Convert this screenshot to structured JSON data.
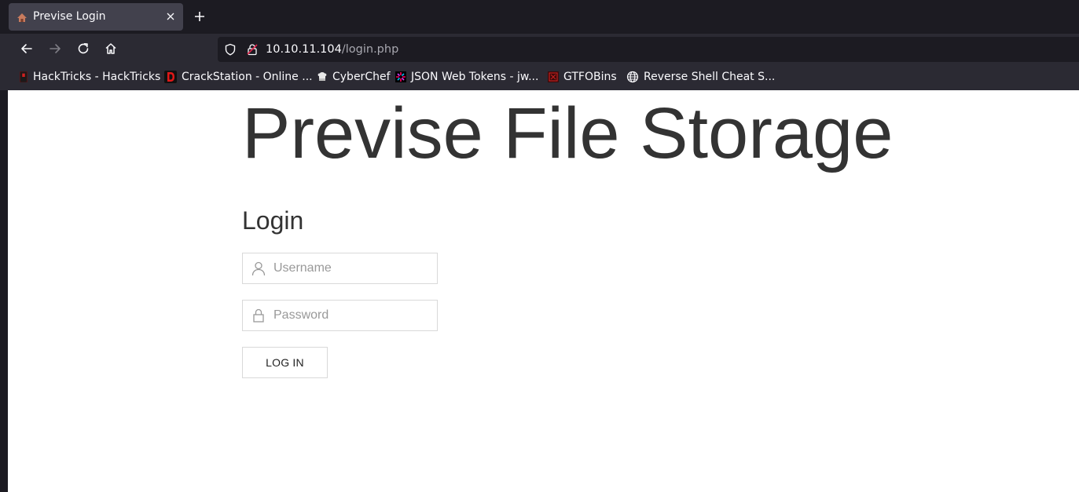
{
  "browser": {
    "tab": {
      "title": "Previse Login",
      "favicon": "previse-favicon-icon"
    },
    "address": {
      "host": "10.10.11.104",
      "path": "/login.php"
    },
    "bookmarks": [
      {
        "label": "HackTricks - HackTricks",
        "icon": "hacktricks-icon"
      },
      {
        "label": "CrackStation - Online ...",
        "icon": "crackstation-icon"
      },
      {
        "label": "CyberChef",
        "icon": "cyberchef-icon"
      },
      {
        "label": "JSON Web Tokens - jw...",
        "icon": "jwt-icon"
      },
      {
        "label": "GTFOBins",
        "icon": "gtfobins-icon"
      },
      {
        "label": "Reverse Shell Cheat S...",
        "icon": "globe-icon"
      }
    ],
    "colors": {
      "tabstrip": "#1c1b22",
      "toolbar": "#2b2a33",
      "active_tab": "#42414d"
    }
  },
  "page": {
    "site_title": "Previse File Storage",
    "login_heading": "Login",
    "username": {
      "placeholder": "Username",
      "value": ""
    },
    "password": {
      "placeholder": "Password",
      "value": ""
    },
    "login_button": "LOG IN",
    "text_color": "#333333"
  }
}
